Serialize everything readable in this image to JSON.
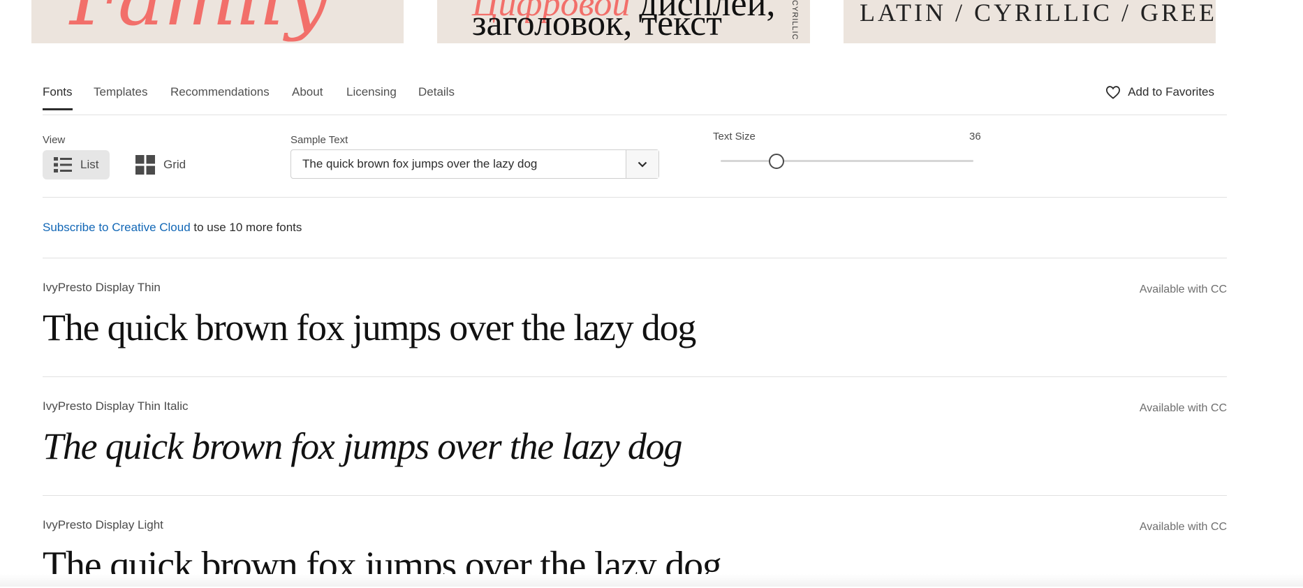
{
  "banner": {
    "tile1_text": "Family",
    "tile2_line1_red": "Цифровой",
    "tile2_line1_black": "дисплей,",
    "tile2_line2": "заголовок, текст",
    "tile2_vertical": "CYRILLIC",
    "tile3_text": "LATIN / CYRILLIC / GREEK"
  },
  "tabs": [
    {
      "label": "Fonts"
    },
    {
      "label": "Templates"
    },
    {
      "label": "Recommendations"
    },
    {
      "label": "About"
    },
    {
      "label": "Licensing"
    },
    {
      "label": "Details"
    }
  ],
  "favorites": {
    "label": "Add to Favorites",
    "icon": "heart-icon"
  },
  "view": {
    "label": "View",
    "list_label": "List",
    "grid_label": "Grid",
    "selected": "List"
  },
  "sample_text": {
    "label": "Sample Text",
    "value": "The quick brown fox jumps over the lazy dog"
  },
  "text_size": {
    "label": "Text Size",
    "value": "36"
  },
  "subscribe": {
    "link": "Subscribe to Creative Cloud",
    "rest": " to use 10 more fonts"
  },
  "fonts": [
    {
      "name": "IvyPresto Display Thin",
      "availability": "Available with CC",
      "sample": "The quick brown fox jumps over the lazy dog",
      "style": "normal"
    },
    {
      "name": "IvyPresto Display Thin Italic",
      "availability": "Available with CC",
      "sample": "The quick brown fox jumps over the lazy dog",
      "style": "italic"
    },
    {
      "name": "IvyPresto Display Light",
      "availability": "Available with CC",
      "sample": "The quick brown fox jumps over the lazy dog",
      "style": "normal"
    }
  ],
  "colors": {
    "link": "#1267b6",
    "banner_bg": "#ece4dd",
    "accent_red": "#f26f6a"
  }
}
